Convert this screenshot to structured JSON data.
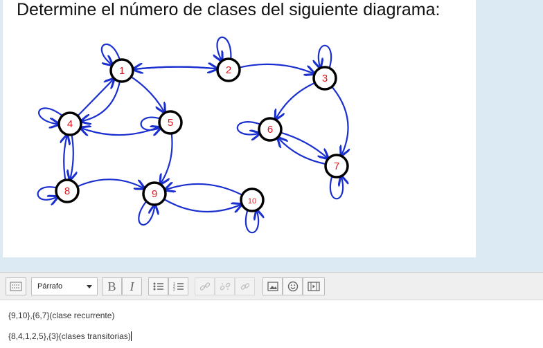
{
  "question": {
    "title": "Determine el número de clases del siguiente diagrama:"
  },
  "diagram": {
    "nodes": [
      {
        "id": "1",
        "label": "1"
      },
      {
        "id": "2",
        "label": "2"
      },
      {
        "id": "3",
        "label": "3"
      },
      {
        "id": "4",
        "label": "4"
      },
      {
        "id": "5",
        "label": "5"
      },
      {
        "id": "6",
        "label": "6"
      },
      {
        "id": "7",
        "label": "7"
      },
      {
        "id": "8",
        "label": "8"
      },
      {
        "id": "9",
        "label": "9"
      },
      {
        "id": "10",
        "label": "10"
      }
    ],
    "edges": [
      [
        "1",
        "1"
      ],
      [
        "1",
        "2"
      ],
      [
        "2",
        "1"
      ],
      [
        "2",
        "2"
      ],
      [
        "2",
        "3"
      ],
      [
        "3",
        "3"
      ],
      [
        "3",
        "6"
      ],
      [
        "3",
        "7"
      ],
      [
        "1",
        "4"
      ],
      [
        "4",
        "1"
      ],
      [
        "1",
        "5"
      ],
      [
        "4",
        "4"
      ],
      [
        "5",
        "5"
      ],
      [
        "5",
        "4"
      ],
      [
        "5",
        "9"
      ],
      [
        "4",
        "8"
      ],
      [
        "8",
        "4"
      ],
      [
        "8",
        "8"
      ],
      [
        "8",
        "9"
      ],
      [
        "9",
        "9"
      ],
      [
        "9",
        "10"
      ],
      [
        "10",
        "9"
      ],
      [
        "10",
        "10"
      ],
      [
        "6",
        "6"
      ],
      [
        "6",
        "7"
      ],
      [
        "7",
        "6"
      ],
      [
        "7",
        "7"
      ]
    ],
    "colors": {
      "edge": "#1a2fcf",
      "node_label": "#e0141e",
      "node_border": "#000000"
    }
  },
  "editor": {
    "format_label": "Párrafo",
    "toolbar_icons": [
      "toolbar-toggle-icon",
      "bold-icon",
      "italic-icon",
      "bullet-list-icon",
      "numbered-list-icon",
      "link-icon",
      "unlink-icon",
      "anchor-icon",
      "image-icon",
      "emoji-icon",
      "media-icon"
    ],
    "bold_label": "B",
    "italic_label": "I",
    "content_lines": [
      "{9,10},{6,7}(clase recurrente)",
      "{8,4,1,2,5},{3}(clases transitorias)"
    ]
  }
}
